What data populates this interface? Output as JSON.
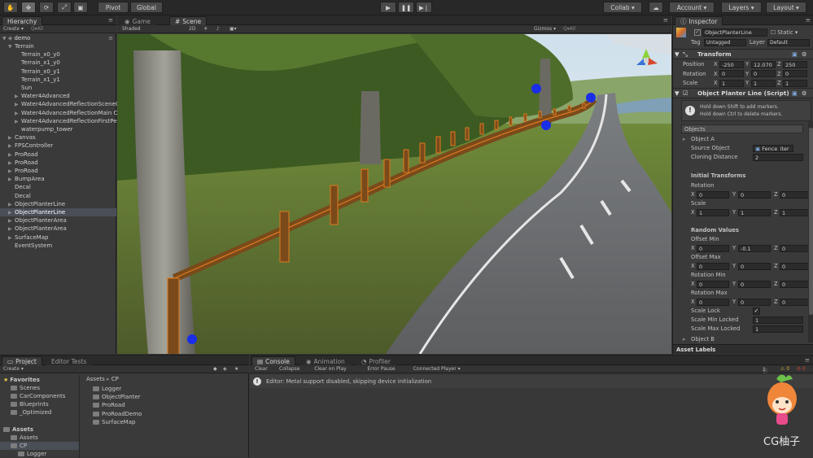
{
  "toolbar": {
    "pivot": "Pivot",
    "global": "Global",
    "collab": "Collab ▾",
    "account": "Account ▾",
    "layers": "Layers ▾",
    "layout": "Layout ▾"
  },
  "hierarchy": {
    "tab": "Hierarchy",
    "create": "Create ▾",
    "search": "Q▾All",
    "scene": "demo",
    "items": [
      {
        "label": "Terrain",
        "blue": true,
        "indent": 1,
        "arrow": "open"
      },
      {
        "label": "Terrain_x0_y0",
        "blue": true,
        "indent": 2
      },
      {
        "label": "Terrain_x1_y0",
        "blue": true,
        "indent": 2
      },
      {
        "label": "Terrain_x0_y1",
        "blue": true,
        "indent": 2
      },
      {
        "label": "Terrain_x1_y1",
        "blue": true,
        "indent": 2
      },
      {
        "label": "Sun",
        "blue": true,
        "indent": 2
      },
      {
        "label": "Water4Advanced",
        "blue": true,
        "indent": 2,
        "arrow": "closed"
      },
      {
        "label": "Water4AdvancedReflectionSceneC",
        "blue": true,
        "indent": 2,
        "arrow": "closed"
      },
      {
        "label": "Water4AdvancedReflectionMain C",
        "blue": true,
        "indent": 2,
        "arrow": "closed"
      },
      {
        "label": "Water4AdvancedReflectionFirstPe",
        "blue": true,
        "indent": 2,
        "arrow": "closed"
      },
      {
        "label": "waterpump_tower",
        "blue": true,
        "indent": 2
      },
      {
        "label": "Canvas",
        "blue": false,
        "indent": 1,
        "arrow": "closed"
      },
      {
        "label": "FPSController",
        "blue": true,
        "indent": 1,
        "arrow": "closed"
      },
      {
        "label": "ProRoad",
        "blue": false,
        "indent": 1,
        "arrow": "closed"
      },
      {
        "label": "ProRoad",
        "blue": false,
        "indent": 1,
        "arrow": "closed"
      },
      {
        "label": "ProRoad",
        "blue": false,
        "indent": 1,
        "arrow": "closed"
      },
      {
        "label": "BumpArea",
        "blue": false,
        "indent": 1,
        "arrow": "closed"
      },
      {
        "label": "Decal",
        "blue": false,
        "indent": 1
      },
      {
        "label": "Decal",
        "blue": false,
        "indent": 1
      },
      {
        "label": "ObjectPlanterLine",
        "blue": false,
        "indent": 1,
        "arrow": "closed"
      },
      {
        "label": "ObjectPlanterLine",
        "blue": false,
        "indent": 1,
        "arrow": "closed",
        "selected": true
      },
      {
        "label": "ObjectPlanterArea",
        "blue": false,
        "indent": 1,
        "arrow": "closed"
      },
      {
        "label": "ObjectPlanterArea",
        "blue": false,
        "indent": 1,
        "arrow": "closed"
      },
      {
        "label": "SurfaceMap",
        "blue": true,
        "indent": 1,
        "arrow": "closed"
      },
      {
        "label": "EventSystem",
        "blue": false,
        "indent": 1
      }
    ]
  },
  "scene": {
    "tab_game": "Game",
    "tab_scene": "Scene",
    "shading": "Shaded",
    "mode2d": "2D",
    "gizmos": "Gizmos ▾",
    "search": "Q▾All"
  },
  "inspector": {
    "tab": "Inspector",
    "object_name": "ObjectPlanterLine",
    "static_label": "Static",
    "tag_label": "Tag",
    "tag_value": "Untagged",
    "layer_label": "Layer",
    "layer_value": "Default",
    "transform": {
      "title": "Transform",
      "position_label": "Position",
      "rotation_label": "Rotation",
      "scale_label": "Scale",
      "position": [
        "-250",
        "12.070",
        "250"
      ],
      "rotation": [
        "0",
        "0",
        "0"
      ],
      "scale": [
        "1",
        "1",
        "1"
      ]
    },
    "script": {
      "title": "Object Planter Line (Script)",
      "help_line1": "Hold down Shift to add markers.",
      "help_line2": "Hold down Ctrl to delete markers.",
      "objects_header": "Objects",
      "object_a": "Object A",
      "source_label": "Source Object",
      "source_value": "Fence_iter",
      "cloning_label": "Cloning Distance",
      "cloning_value": "2",
      "initial_header": "Initial Transforms",
      "rotation_label": "Rotation",
      "rotation": [
        "0",
        "0",
        "0"
      ],
      "scale_label": "Scale",
      "scale": [
        "1",
        "1",
        "1"
      ],
      "random_header": "Random Values",
      "offset_min_label": "Offset Min",
      "offset_min": [
        "0",
        "-0.1",
        "0"
      ],
      "offset_max_label": "Offset Max",
      "offset_max": [
        "0",
        "0",
        "0"
      ],
      "rotation_min_label": "Rotation Min",
      "rotation_min": [
        "0",
        "0",
        "0"
      ],
      "rotation_max_label": "Rotation Max",
      "rotation_max": [
        "0",
        "0",
        "0"
      ],
      "scale_lock_label": "Scale Lock",
      "scale_min_label": "Scale Min Locked",
      "scale_min_value": "1",
      "scale_max_label": "Scale Max Locked",
      "scale_max_value": "1",
      "object_b": "Object B"
    },
    "asset_labels": "Asset Labels"
  },
  "project": {
    "tab_project": "Project",
    "tab_editor_tests": "Editor Tests",
    "create": "Create ▾",
    "tree": [
      {
        "label": "Favorites",
        "indent": 0,
        "icon": "star",
        "bold": true
      },
      {
        "label": "Scenes",
        "indent": 1
      },
      {
        "label": "CarComponents",
        "indent": 1
      },
      {
        "label": "Blueprints",
        "indent": 1
      },
      {
        "label": "_Optimized",
        "indent": 1
      },
      {
        "label": "",
        "indent": 0
      },
      {
        "label": "Assets",
        "indent": 0,
        "folder": true,
        "bold": true
      },
      {
        "label": "Assets",
        "indent": 1,
        "folder": true
      },
      {
        "label": "CP",
        "indent": 1,
        "folder": true,
        "selected": true
      },
      {
        "label": "Logger",
        "indent": 2,
        "folder": true
      }
    ],
    "breadcrumb_root": "Assets",
    "breadcrumb_sep": "▸",
    "breadcrumb_leaf": "CP",
    "folders": [
      "Logger",
      "ObjectPlanter",
      "ProRoad",
      "ProRoadDemo",
      "SurfaceMap"
    ]
  },
  "console": {
    "tab_console": "Console",
    "tab_animation": "Animation",
    "tab_profiler": "Profiler",
    "buttons": [
      "Clear",
      "Collapse",
      "Clear on Play",
      "Error Pause",
      "Connected Player ▾"
    ],
    "message": "Editor: Metal support disabled, skipping device initialization",
    "count": "1"
  },
  "watermark": "CG柚子"
}
